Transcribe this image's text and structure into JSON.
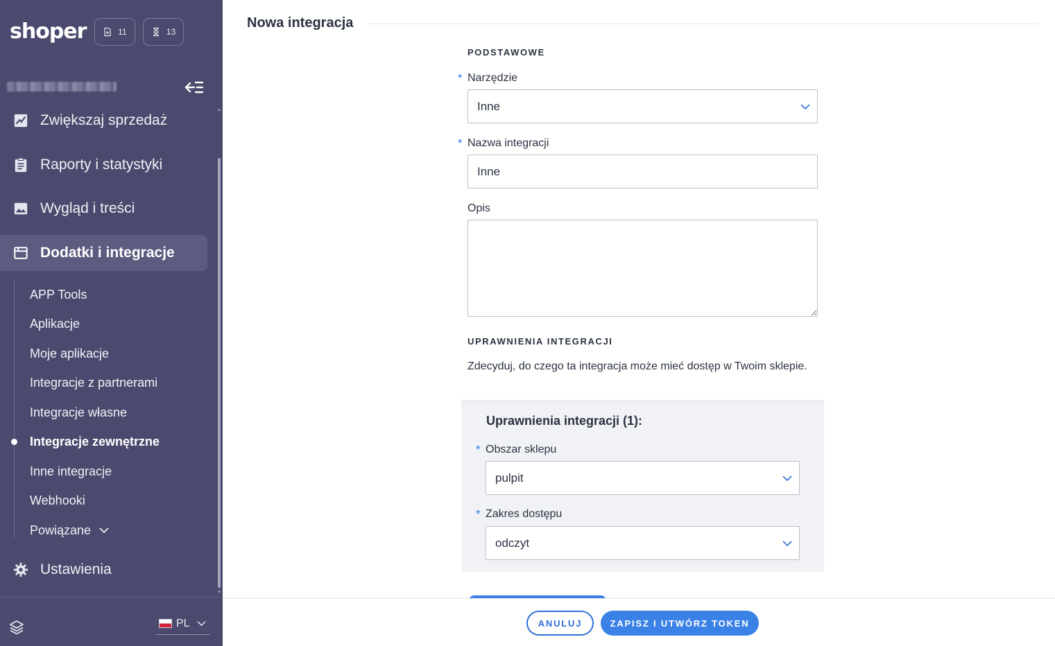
{
  "sidebar": {
    "logo": "shoper",
    "badges": {
      "notes_count": "11",
      "tasks_count": "13"
    },
    "nav": [
      {
        "label": "Zwiększaj sprzedaż",
        "icon": "trend-chart-icon"
      },
      {
        "label": "Raporty i statystyki",
        "icon": "clipboard-icon"
      },
      {
        "label": "Wygląd i treści",
        "icon": "image-icon"
      },
      {
        "label": "Dodatki i integracje",
        "icon": "window-icon",
        "active": true
      }
    ],
    "sub_items": [
      {
        "label": "APP Tools"
      },
      {
        "label": "Aplikacje"
      },
      {
        "label": "Moje aplikacje"
      },
      {
        "label": "Integracje z partnerami"
      },
      {
        "label": "Integracje własne"
      },
      {
        "label": "Integracje zewnętrzne",
        "current": true
      },
      {
        "label": "Inne integracje"
      },
      {
        "label": "Webhooki"
      },
      {
        "label": "Powiązane"
      }
    ],
    "settings": {
      "label": "Ustawienia",
      "icon": "gear-icon"
    },
    "language": "PL"
  },
  "main": {
    "section_title": "Nowa integracja",
    "basic": {
      "heading": "PODSTAWOWE",
      "tool": {
        "label": "Narzędzie",
        "value": "Inne",
        "required": "*"
      },
      "name": {
        "label": "Nazwa integracji",
        "value": "Inne",
        "required": "*"
      },
      "description": {
        "label": "Opis",
        "value": ""
      }
    },
    "permissions": {
      "heading": "UPRAWNIENIA INTEGRACJI",
      "description": "Zdecyduj, do czego ta integracja może mieć dostęp w Twoim sklepie.",
      "panel_title": "Uprawnienia integracji (1):",
      "area": {
        "label": "Obszar sklepu",
        "value": "pulpit",
        "required": "*"
      },
      "scope": {
        "label": "Zakres dostępu",
        "value": "odczyt",
        "required": "*"
      }
    }
  },
  "footer": {
    "cancel_label": "ANULUJ",
    "save_label": "ZAPISZ I UTWÓRZ TOKEN"
  },
  "colors": {
    "sidebar_bg": "#4b4a6e",
    "accent": "#3b82e6",
    "panel_bg": "#f1f2f6"
  }
}
